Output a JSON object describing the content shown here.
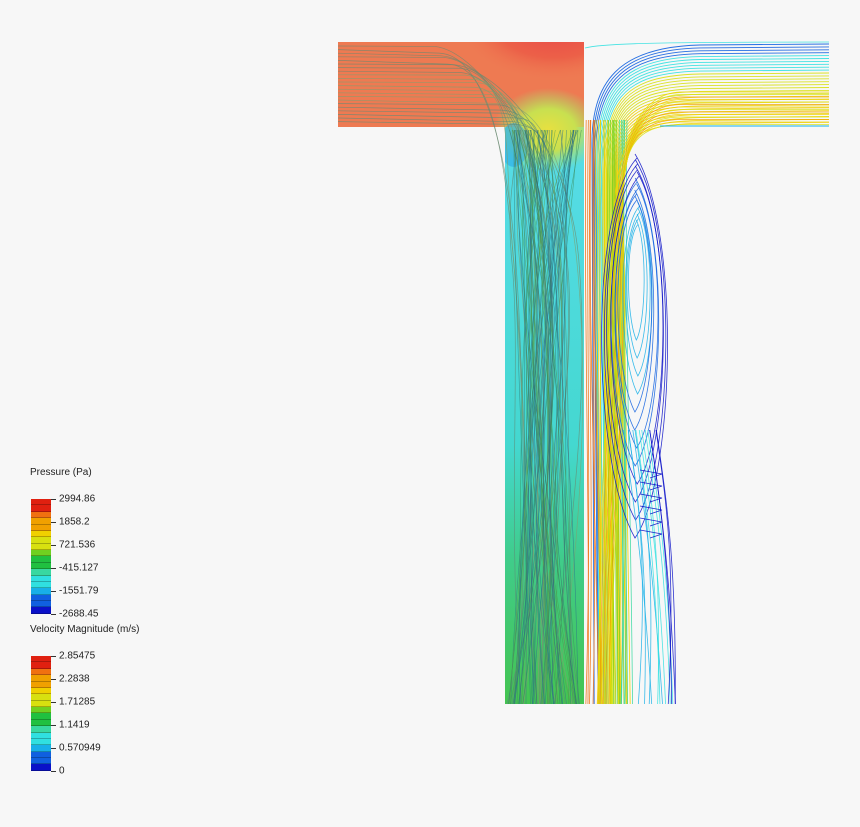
{
  "legends": {
    "pressure": {
      "title": "Pressure (Pa)",
      "ticks": [
        "2994.86",
        "1858.2",
        "721.536",
        "-415.127",
        "-1551.79",
        "-2688.45"
      ]
    },
    "velocity": {
      "title": "Velocity Magnitude (m/s)",
      "ticks": [
        "2.85475",
        "2.2838",
        "1.71285",
        "1.1419",
        "0.570949",
        "0"
      ]
    }
  },
  "colormap": [
    "#0a10c8",
    "#1060e0",
    "#18b0e8",
    "#30e0e0",
    "#38d8a0",
    "#20c040",
    "#70d020",
    "#d8e010",
    "#f0d000",
    "#f0a000",
    "#f07010",
    "#e02010"
  ],
  "colors": {
    "background": "#f7f7f7",
    "pressure_high": "#ee7a52",
    "pressure_peak": "#e74245",
    "pressure_low": "#48d8e0",
    "pressure_mid": "#3cc878"
  }
}
